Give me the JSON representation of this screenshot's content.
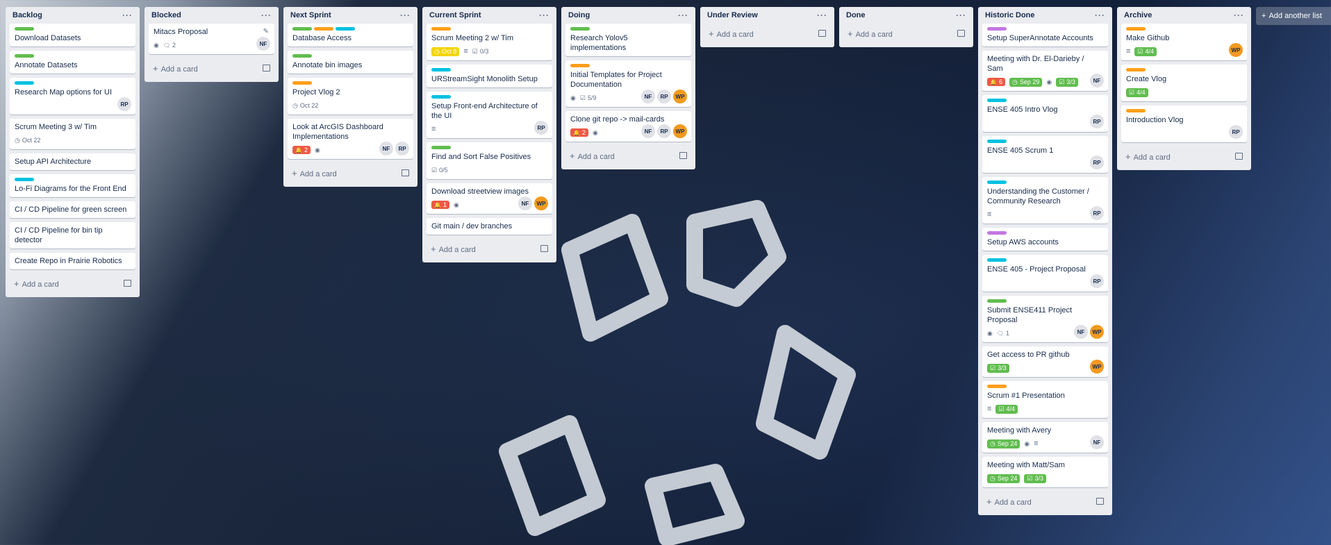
{
  "colors": {
    "green": "#61bd4f",
    "orange": "#ff9f1a",
    "cyan": "#00c2e0",
    "purple": "#c377e0",
    "red": "#eb5a46",
    "yellow": "#f2d600"
  },
  "add_card_label": "Add a card",
  "add_list_label": "Add another list",
  "lists": [
    {
      "title": "Backlog",
      "cards": [
        {
          "title": "Download Datasets",
          "labels": [
            "green"
          ]
        },
        {
          "title": "Annotate Datasets",
          "labels": [
            "green"
          ]
        },
        {
          "title": "Research Map options for UI",
          "labels": [
            "cyan"
          ],
          "members": [
            "RP"
          ]
        },
        {
          "title": "Scrum Meeting 3 w/ Tim",
          "due": "Oct 22"
        },
        {
          "title": "Setup API Architecture"
        },
        {
          "title": "Lo-Fi Diagrams for the Front End",
          "labels": [
            "cyan"
          ]
        },
        {
          "title": "CI / CD Pipeline for green screen"
        },
        {
          "title": "CI / CD Pipeline for bin tip detector"
        },
        {
          "title": "Create Repo in Prairie Robotics"
        }
      ]
    },
    {
      "title": "Blocked",
      "cards": [
        {
          "title": "Mitacs Proposal",
          "watch": true,
          "comments": "2",
          "members": [
            "NF"
          ],
          "edit": true
        }
      ]
    },
    {
      "title": "Next Sprint",
      "cards": [
        {
          "title": "Database Access",
          "labels": [
            "green",
            "orange",
            "cyan"
          ]
        },
        {
          "title": "Annotate bin images",
          "labels": [
            "green"
          ]
        },
        {
          "title": "Project Vlog 2",
          "labels": [
            "orange"
          ],
          "due": "Oct 22"
        },
        {
          "title": "Look at ArcGIS Dashboard Implementations",
          "alert": {
            "value": "2",
            "color": "red"
          },
          "watch": true,
          "members": [
            "NF",
            "RP"
          ]
        }
      ]
    },
    {
      "title": "Current Sprint",
      "cards": [
        {
          "title": "Scrum Meeting 2 w/ Tim",
          "labels": [
            "orange"
          ],
          "date_pill": {
            "value": "Oct 8",
            "color": "yellow"
          },
          "desc": true,
          "checklist": "0/3"
        },
        {
          "title": "URStreamSight Monolith Setup",
          "labels": [
            "cyan"
          ]
        },
        {
          "title": "Setup Front-end Architecture of the UI",
          "labels": [
            "cyan"
          ],
          "desc": true,
          "members": [
            "RP"
          ]
        },
        {
          "title": "Find and Sort False Positives",
          "labels": [
            "green"
          ],
          "checklist": "0/5"
        },
        {
          "title": "Download streetview images",
          "alert": {
            "value": "1",
            "color": "red"
          },
          "watch": true,
          "members": [
            "NF",
            "WP"
          ]
        },
        {
          "title": "Git main / dev branches"
        }
      ]
    },
    {
      "title": "Doing",
      "cards": [
        {
          "title": "Research Yolov5 implementations",
          "labels": [
            "green"
          ]
        },
        {
          "title": "Initial Templates for Project Documentation",
          "labels": [
            "orange"
          ],
          "watch": true,
          "checklist": "5/9",
          "members": [
            "NF",
            "RP",
            "WP"
          ]
        },
        {
          "title": "Clone git repo -> mail-cards",
          "alert": {
            "value": "2",
            "color": "red"
          },
          "watch": true,
          "members": [
            "NF",
            "RP",
            "WP"
          ]
        }
      ]
    },
    {
      "title": "Under Review",
      "cards": []
    },
    {
      "title": "Done",
      "cards": []
    },
    {
      "title": "Historic Done",
      "cards": [
        {
          "title": "Setup SuperAnnotate Accounts",
          "labels": [
            "purple"
          ]
        },
        {
          "title": "Meeting with Dr. El-Darieby / Sam",
          "alert": {
            "value": "6",
            "color": "red"
          },
          "watch": true,
          "date_pill": {
            "value": "Sep 29",
            "color": "green"
          },
          "check_pill": {
            "value": "3/3",
            "color": "green"
          },
          "members": [
            "NF"
          ]
        },
        {
          "title": "ENSE 405 Intro Vlog",
          "labels": [
            "cyan"
          ],
          "members": [
            "RP"
          ]
        },
        {
          "title": "ENSE 405 Scrum 1",
          "labels": [
            "cyan"
          ],
          "members": [
            "RP"
          ]
        },
        {
          "title": "Understanding the Customer / Community Research",
          "labels": [
            "cyan"
          ],
          "desc": true,
          "members": [
            "RP"
          ]
        },
        {
          "title": "Setup AWS accounts",
          "labels": [
            "purple"
          ]
        },
        {
          "title": "ENSE 405 - Project Proposal",
          "labels": [
            "cyan"
          ],
          "members": [
            "RP"
          ]
        },
        {
          "title": "Submit ENSE411 Project Proposal",
          "labels": [
            "green"
          ],
          "watch": true,
          "comments": "1",
          "members": [
            "NF",
            "WP"
          ]
        },
        {
          "title": "Get access to PR github",
          "check_pill": {
            "value": "3/3",
            "color": "green"
          },
          "members": [
            "WP"
          ]
        },
        {
          "title": "Scrum #1 Presentation",
          "labels": [
            "orange"
          ],
          "desc": true,
          "check_pill": {
            "value": "4/4",
            "color": "green"
          }
        },
        {
          "title": "Meeting with Avery",
          "watch": true,
          "date_pill": {
            "value": "Sep 24",
            "color": "green"
          },
          "desc": true,
          "members": [
            "NF"
          ]
        },
        {
          "title": "Meeting with Matt/Sam",
          "date_pill": {
            "value": "Sep 24",
            "color": "green"
          },
          "check_pill": {
            "value": "3/3",
            "color": "green"
          }
        }
      ]
    },
    {
      "title": "Archive",
      "cards": [
        {
          "title": "Make Github",
          "labels": [
            "orange"
          ],
          "desc": true,
          "check_pill": {
            "value": "4/4",
            "color": "green"
          },
          "members": [
            "WP"
          ]
        },
        {
          "title": "Create Vlog",
          "labels": [
            "orange"
          ],
          "check_pill": {
            "value": "4/4",
            "color": "green"
          }
        },
        {
          "title": "Introduction Vlog",
          "labels": [
            "orange"
          ],
          "members": [
            "RP"
          ]
        }
      ]
    }
  ]
}
